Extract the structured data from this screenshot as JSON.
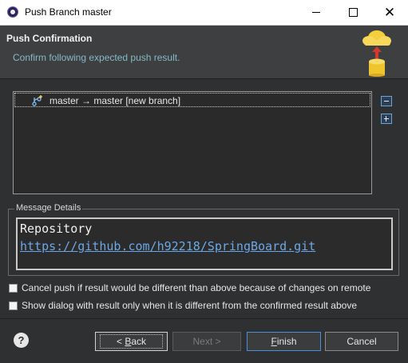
{
  "window": {
    "title": "Push Branch master"
  },
  "header": {
    "title": "Push Confirmation",
    "message": "Confirm following expected push result."
  },
  "result": {
    "rows": [
      {
        "label": "master → master [new branch]"
      }
    ]
  },
  "message_details": {
    "legend": "Message Details",
    "repository_label": "Repository",
    "repository_url": "https://github.com/h92218/SpringBoard.git"
  },
  "options": {
    "cancel_push_label": "Cancel push if result would be different than above because of changes on remote",
    "cancel_push_checked": false,
    "show_dialog_label": "Show dialog with result only when it is different from the confirmed result above",
    "show_dialog_checked": false
  },
  "buttons": {
    "back_prefix": "< ",
    "back_mnemonic": "B",
    "back_rest": "ack",
    "next": "Next >",
    "finish_mnemonic": "F",
    "finish_rest": "inish",
    "cancel": "Cancel"
  },
  "icons": {
    "app": "eclipse-icon",
    "header": "cloud-push-database-icon",
    "branch": "new-branch-icon",
    "collapse": "collapse-all-icon",
    "expand": "expand-all-icon",
    "help": "help-icon"
  },
  "colors": {
    "background": "#2f3032",
    "accent": "#4a8fd8",
    "link": "#6aa8e8",
    "subtitle": "#86b9c6"
  }
}
